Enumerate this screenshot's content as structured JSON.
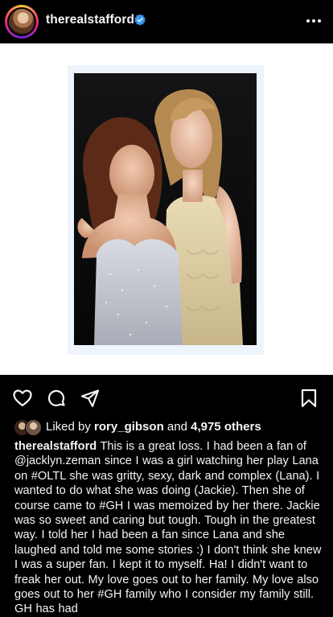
{
  "header": {
    "username": "therealstafford",
    "verified_icon": "verified-badge-icon",
    "more_icon": "more-options-icon"
  },
  "actions": {
    "icons": [
      "heart-icon",
      "comment-icon",
      "share-icon",
      "bookmark-icon"
    ]
  },
  "likes": {
    "prefix": "Liked by ",
    "user": "rory_gibson",
    "middle": " and ",
    "count": "4,975 others"
  },
  "caption": {
    "username": "therealstafford",
    "text": " This is a great loss. I had been a fan of @jacklyn.zeman since I was a girl watching her play Lana on #OLTL she was gritty, sexy, dark and complex (Lana). I wanted to do what she was doing (Jackie). Then she of course came to #GH I was memoized by her there. Jackie was so sweet and caring but tough. Tough in the greatest way. I told her I had been a fan since Lana and she laughed and told me some stories :) I don't think she knew I was a super fan. I kept it to myself. Ha! I didn't want to freak her out. My love goes out to her family. My love also goes out to her #GH family who I consider my family still. GH has had"
  },
  "colors": {
    "background": "#000000",
    "text": "#f5f5f5",
    "verified": "#3897f0",
    "image_bg": "#ffffff"
  }
}
